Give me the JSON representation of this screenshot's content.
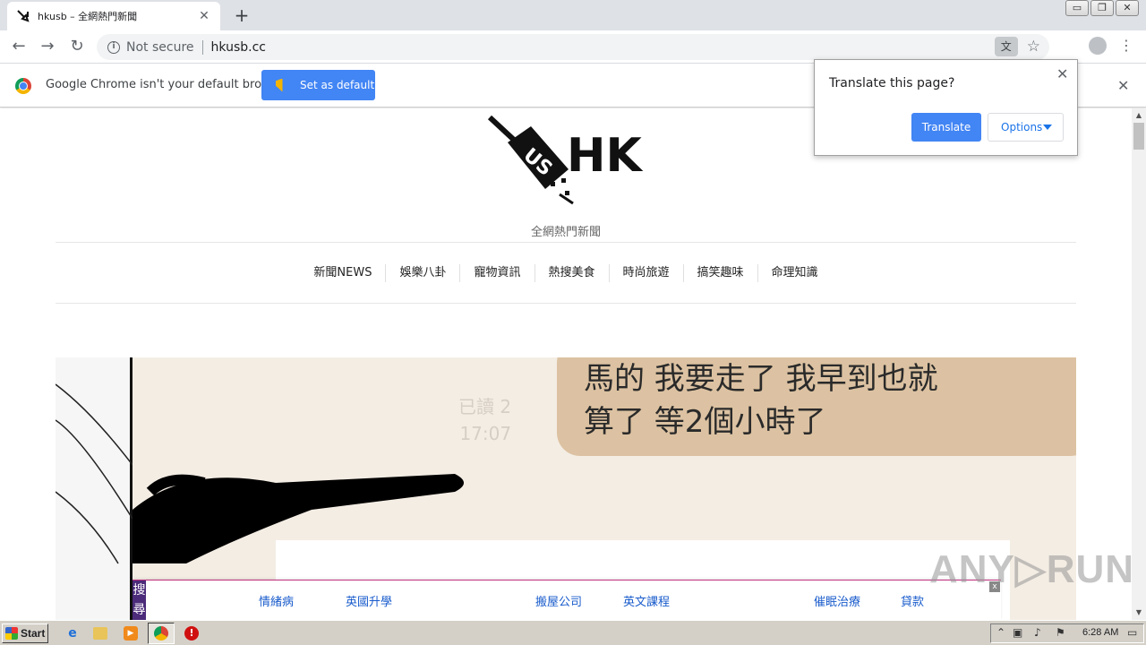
{
  "tab": {
    "title": "hkusb – 全網熱門新聞",
    "close_glyph": "✕"
  },
  "newtab_glyph": "+",
  "window_controls": [
    "▭",
    "❐",
    "✕"
  ],
  "toolbar": {
    "back_glyph": "←",
    "forward_glyph": "→",
    "reload_glyph": "↻",
    "security_label": "Not secure",
    "url": "hkusb.cc",
    "menu_glyph": "⋮",
    "star_glyph": "☆",
    "translate_glyph": "文"
  },
  "infobar": {
    "message": "Google Chrome isn't your default browser",
    "button_label": "Set as default",
    "close_glyph": "✕"
  },
  "translate_popup": {
    "question": "Translate this page?",
    "translate_label": "Translate",
    "options_label": "Options",
    "close_glyph": "✕"
  },
  "site": {
    "logo_text": "HK",
    "tagline": "全網熱門新聞",
    "nav": [
      "新聞NEWS",
      "娛樂八卦",
      "寵物資訊",
      "熱搜美食",
      "時尚旅遊",
      "搞笑趣味",
      "命理知識"
    ]
  },
  "hero": {
    "bubble_lines": [
      "馬的 我要走了 我早到也就",
      "算了 等2個小時了"
    ],
    "read_status": "已讀 2",
    "read_time": "17:07"
  },
  "adbar": {
    "search_tag": "搜尋",
    "links": [
      "情緒病",
      "英國升學",
      "搬屋公司",
      "英文課程",
      "催眠治療",
      "貸款"
    ],
    "close_glyph": "x"
  },
  "watermark": "ANY▷RUN",
  "scrollbar": {
    "up_glyph": "▲",
    "down_glyph": "▼"
  },
  "taskbar": {
    "start_label": "Start",
    "clock": "6:28 AM"
  }
}
